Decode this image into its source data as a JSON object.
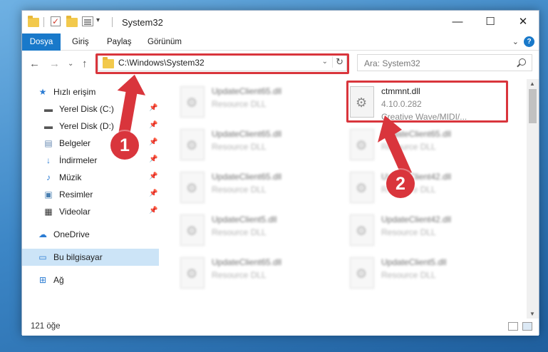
{
  "window": {
    "title": "System32"
  },
  "window_controls": {
    "minimize": "—",
    "maximize": "☐",
    "close": "✕"
  },
  "ribbon": {
    "tabs": [
      "Dosya",
      "Giriş",
      "Paylaş",
      "Görünüm"
    ],
    "collapse": "⌄",
    "help": "?"
  },
  "nav": {
    "back": "←",
    "forward": "→",
    "recent": "⌄",
    "up": "↑"
  },
  "address": {
    "path": "C:\\Windows\\System32",
    "dropdown": "⌄",
    "refresh": "↻"
  },
  "search": {
    "placeholder": "Ara: System32"
  },
  "sidebar": {
    "items": [
      {
        "label": "Hızlı erişim",
        "icon": "star-icon",
        "pinned": false
      },
      {
        "label": "Yerel Disk (C:)",
        "icon": "drive-icon",
        "pinned": true
      },
      {
        "label": "Yerel Disk (D:)",
        "icon": "drive-icon",
        "pinned": true
      },
      {
        "label": "Belgeler",
        "icon": "documents-icon",
        "pinned": true
      },
      {
        "label": "İndirmeler",
        "icon": "download-icon",
        "pinned": true
      },
      {
        "label": "Müzik",
        "icon": "music-icon",
        "pinned": true
      },
      {
        "label": "Resimler",
        "icon": "pictures-icon",
        "pinned": true
      },
      {
        "label": "Videolar",
        "icon": "videos-icon",
        "pinned": true
      },
      {
        "label": "OneDrive",
        "icon": "cloud-icon",
        "pinned": false
      },
      {
        "label": "Bu bilgisayar",
        "icon": "computer-icon",
        "pinned": false,
        "selected": true
      },
      {
        "label": "Ağ",
        "icon": "network-icon",
        "pinned": false
      }
    ],
    "pin_glyph": "📌"
  },
  "files": {
    "highlighted": {
      "name": "ctmmnt.dll",
      "version": "4.10.0.282",
      "description": "Creative Wave/MIDI/..."
    },
    "others": [
      {
        "name": "UpdateClient65.dll",
        "type": "Resource DLL"
      },
      {
        "name": "UpdateClient65.dll",
        "type": "Resource DLL"
      },
      {
        "name": "UpdateClient65.dll",
        "type": "Resource DLL"
      },
      {
        "name": "UpdateClient65.dll",
        "type": "Resource DLL"
      },
      {
        "name": "UpdateClient42.dll",
        "type": "Resource DLL"
      },
      {
        "name": "UpdateClient5.dll",
        "type": "Resource DLL"
      },
      {
        "name": "UpdateClient42.dll",
        "type": "Resource DLL"
      },
      {
        "name": "UpdateClient65.dll",
        "type": "Resource DLL"
      },
      {
        "name": "UpdateClient5.dll",
        "type": "Resource DLL"
      }
    ]
  },
  "status": {
    "count": "121 öğe"
  },
  "annotations": {
    "step1": "1",
    "step2": "2",
    "color": "#d9353c"
  }
}
